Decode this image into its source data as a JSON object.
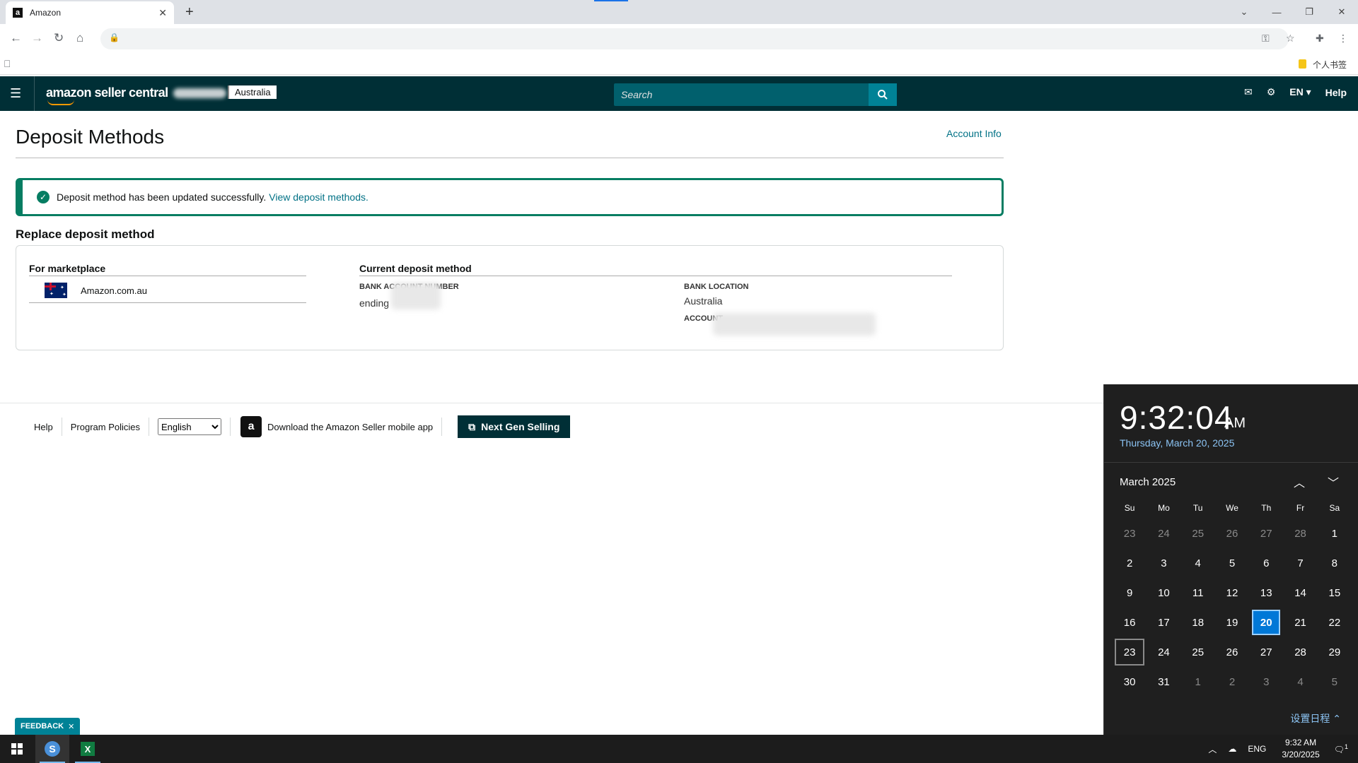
{
  "browser": {
    "tab_title": "Amazon",
    "tab_favicon": "a",
    "bookmark_folder": "个人书签"
  },
  "header": {
    "logo": "amazon seller central",
    "marketplace": "Australia",
    "search_placeholder": "Search",
    "lang": "EN ▾",
    "help": "Help"
  },
  "page": {
    "title": "Deposit Methods",
    "account_info": "Account Info",
    "alert": {
      "message": "Deposit method has been updated successfully.",
      "link": "View deposit methods."
    },
    "section_title": "Replace deposit method",
    "card": {
      "for_marketplace_header": "For marketplace",
      "marketplace_name": "Amazon.com.au",
      "current_method_header": "Current deposit method",
      "bank_account_label": "BANK ACCOUNT NUMBER",
      "bank_account_value": "ending",
      "bank_location_label": "BANK LOCATION",
      "bank_location_value": "Australia",
      "account_label": "ACCOUNT"
    }
  },
  "footer": {
    "help": "Help",
    "program_policies": "Program Policies",
    "language_selected": "English",
    "download_app": "Download the Amazon Seller mobile app",
    "next_gen": "Next Gen Selling",
    "feedback": "FEEDBACK"
  },
  "clock": {
    "time": "9:32:04",
    "ampm": "AM",
    "date": "Thursday, March 20, 2025",
    "month": "March 2025",
    "days_of_week": [
      "Su",
      "Mo",
      "Tu",
      "We",
      "Th",
      "Fr",
      "Sa"
    ],
    "weeks": [
      [
        "23",
        "24",
        "25",
        "26",
        "27",
        "28",
        "1"
      ],
      [
        "2",
        "3",
        "4",
        "5",
        "6",
        "7",
        "8"
      ],
      [
        "9",
        "10",
        "11",
        "12",
        "13",
        "14",
        "15"
      ],
      [
        "16",
        "17",
        "18",
        "19",
        "20",
        "21",
        "22"
      ],
      [
        "23",
        "24",
        "25",
        "26",
        "27",
        "28",
        "29"
      ],
      [
        "30",
        "31",
        "1",
        "2",
        "3",
        "4",
        "5"
      ]
    ],
    "today": "20",
    "agenda_link": "设置日程 ⌃"
  },
  "taskbar": {
    "lang": "ENG",
    "time": "9:32 AM",
    "date": "3/20/2025",
    "notification_count": "1"
  }
}
